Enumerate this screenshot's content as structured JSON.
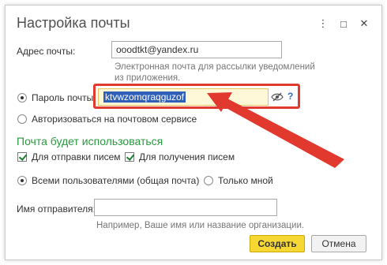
{
  "dialog": {
    "title": "Настройка почты",
    "window_buttons": [
      "⋮",
      "□",
      "✕"
    ]
  },
  "email": {
    "label": "Адрес почты:",
    "value": "ooodtkt@yandex.ru",
    "hint_line1": "Электронная почта для рассылки уведомлений",
    "hint_line2": "из приложения."
  },
  "password": {
    "radio_label": "Пароль почты:",
    "value": "ktvwzomqraqguzof",
    "help": "?"
  },
  "auth_radio_label": "Авторизоваться на почтовом сервисе",
  "usage": {
    "section_title": "Почта будет использоваться",
    "send_label": "Для отправки писем",
    "receive_label": "Для получения писем",
    "all_users_label": "Всеми пользователями (общая почта)",
    "only_me_label": "Только мной"
  },
  "sender": {
    "label": "Имя отправителя:",
    "value": "",
    "hint": "Например, Ваше имя или название организации."
  },
  "buttons": {
    "create": "Создать",
    "cancel": "Отмена"
  },
  "colors": {
    "highlight": "#e2392f",
    "section": "#2a9a40",
    "primary_button": "#f7d733"
  }
}
